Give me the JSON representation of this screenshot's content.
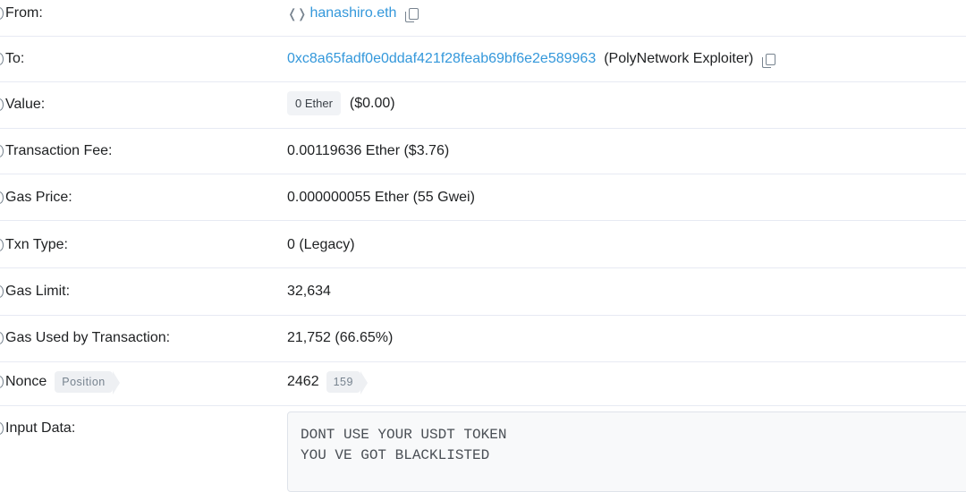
{
  "rows": {
    "from": {
      "label": "From:",
      "ens": "hanashiro.eth"
    },
    "to": {
      "label": "To:",
      "address": "0xc8a65fadf0e0ddaf421f28feab69bf6e2e589963",
      "name_tag": "(PolyNetwork Exploiter)"
    },
    "value": {
      "label": "Value:",
      "amount": "0 Ether",
      "usd": "($0.00)"
    },
    "fee": {
      "label": "Transaction Fee:",
      "value": "0.00119636 Ether ($3.76)"
    },
    "gas_price": {
      "label": "Gas Price:",
      "value": "0.000000055 Ether (55 Gwei)"
    },
    "txn_type": {
      "label": "Txn Type:",
      "value": "0 (Legacy)"
    },
    "gas_limit": {
      "label": "Gas Limit:",
      "value": "32,634"
    },
    "gas_used": {
      "label": "Gas Used by Transaction:",
      "value": "21,752 (66.65%)"
    },
    "nonce": {
      "label": "Nonce",
      "position_tag": "Position",
      "value": "2462",
      "position_value": "159"
    },
    "input": {
      "label": "Input Data:",
      "line1": "DONT USE YOUR USDT TOKEN",
      "line2": "YOU VE GOT BLACKLISTED"
    }
  },
  "icons": {
    "info": "info-icon",
    "copy": "copy-icon",
    "ens": "ens-icon"
  },
  "colors": {
    "link": "#3498db",
    "muted": "#77838f",
    "border": "#e7eaf3"
  }
}
